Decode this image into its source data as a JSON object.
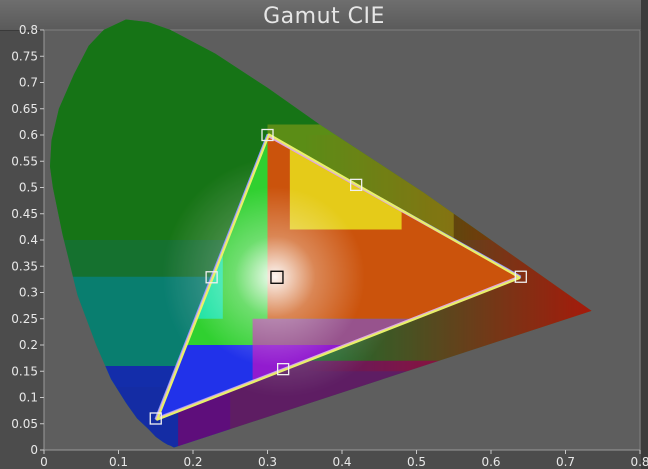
{
  "chart_data": {
    "type": "scatter",
    "title": "Gamut CIE",
    "xlabel": "",
    "ylabel": "",
    "xlim": [
      0,
      0.8
    ],
    "ylim": [
      0,
      0.8
    ],
    "x_ticks": [
      "0",
      "0.1",
      "0.2",
      "0.3",
      "0.4",
      "0.5",
      "0.6",
      "0.7",
      "0.8"
    ],
    "y_ticks": [
      "0",
      "0.05",
      "0.1",
      "0.15",
      "0.2",
      "0.25",
      "0.3",
      "0.35",
      "0.4",
      "0.45",
      "0.5",
      "0.55",
      "0.6",
      "0.65",
      "0.7",
      "0.75",
      "0.8"
    ],
    "x_tick_values": [
      0,
      0.1,
      0.2,
      0.3,
      0.4,
      0.5,
      0.6,
      0.7,
      0.8
    ],
    "y_tick_values": [
      0,
      0.05,
      0.1,
      0.15,
      0.2,
      0.25,
      0.3,
      0.35,
      0.4,
      0.45,
      0.5,
      0.55,
      0.6,
      0.65,
      0.7,
      0.75,
      0.8
    ],
    "grid": false,
    "spectral_locus": [
      [
        0.175,
        0.005
      ],
      [
        0.174,
        0.005
      ],
      [
        0.17,
        0.008
      ],
      [
        0.166,
        0.01
      ],
      [
        0.16,
        0.015
      ],
      [
        0.15,
        0.025
      ],
      [
        0.14,
        0.04
      ],
      [
        0.125,
        0.06
      ],
      [
        0.11,
        0.09
      ],
      [
        0.09,
        0.135
      ],
      [
        0.07,
        0.2
      ],
      [
        0.045,
        0.295
      ],
      [
        0.025,
        0.41
      ],
      [
        0.012,
        0.5
      ],
      [
        0.008,
        0.54
      ],
      [
        0.01,
        0.59
      ],
      [
        0.02,
        0.65
      ],
      [
        0.04,
        0.715
      ],
      [
        0.06,
        0.77
      ],
      [
        0.08,
        0.8
      ],
      [
        0.11,
        0.82
      ],
      [
        0.14,
        0.815
      ],
      [
        0.17,
        0.8
      ],
      [
        0.23,
        0.755
      ],
      [
        0.3,
        0.69
      ],
      [
        0.37,
        0.62
      ],
      [
        0.44,
        0.555
      ],
      [
        0.51,
        0.49
      ],
      [
        0.58,
        0.42
      ],
      [
        0.64,
        0.36
      ],
      [
        0.69,
        0.31
      ],
      [
        0.735,
        0.265
      ]
    ],
    "series": [
      {
        "color": "#8a9cff",
        "points": [
          [
            0.64,
            0.33
          ],
          [
            0.3,
            0.6
          ],
          [
            0.15,
            0.06
          ],
          [
            0.64,
            0.33
          ]
        ]
      },
      {
        "color": "#e0a8e0",
        "points": [
          [
            0.638,
            0.33
          ],
          [
            0.301,
            0.598
          ],
          [
            0.151,
            0.059
          ],
          [
            0.638,
            0.33
          ]
        ]
      },
      {
        "color": "#e8f06a",
        "points": [
          [
            0.639,
            0.328
          ],
          [
            0.302,
            0.601
          ],
          [
            0.152,
            0.058
          ],
          [
            0.639,
            0.328
          ]
        ]
      }
    ],
    "target_markers": [
      [
        0.64,
        0.33
      ],
      [
        0.3,
        0.6
      ],
      [
        0.15,
        0.06
      ],
      [
        0.225,
        0.329
      ],
      [
        0.321,
        0.154
      ],
      [
        0.419,
        0.505
      ],
      [
        0.3127,
        0.329
      ]
    ]
  }
}
